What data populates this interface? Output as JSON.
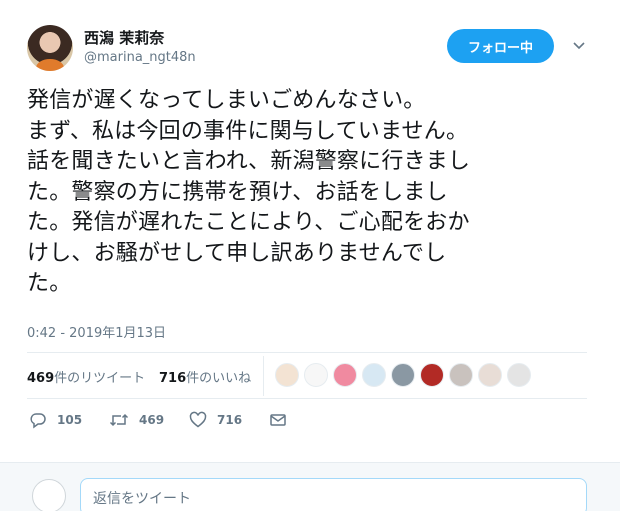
{
  "user": {
    "display_name": "西潟 茉莉奈",
    "handle": "@marina_ngt48n"
  },
  "follow_button": {
    "label": "フォロー中"
  },
  "tweet": {
    "lines": [
      "発信が遅くなってしまいごめんなさい。",
      "まず、私は今回の事件に関与していません。",
      "話を聞きたいと言われ、新潟警察に行きまし",
      "た。警察の方に携帯を預け、お話をしまし",
      "た。発信が遅れたことにより、ご心配をおか",
      "けし、お騒がせして申し訳ありませんでし",
      "た。"
    ],
    "timestamp": "0:42 - 2019年1月13日"
  },
  "stats": {
    "retweets_count": "469",
    "retweets_label": "件のリツイート",
    "likes_count": "716",
    "likes_label": "件のいいね"
  },
  "actions": {
    "reply_count": "105",
    "retweet_count": "469",
    "like_count": "716"
  },
  "reply_box": {
    "placeholder": "返信をツイート"
  },
  "colors": {
    "accent": "#1da1f2",
    "secondary_text": "#657786"
  }
}
